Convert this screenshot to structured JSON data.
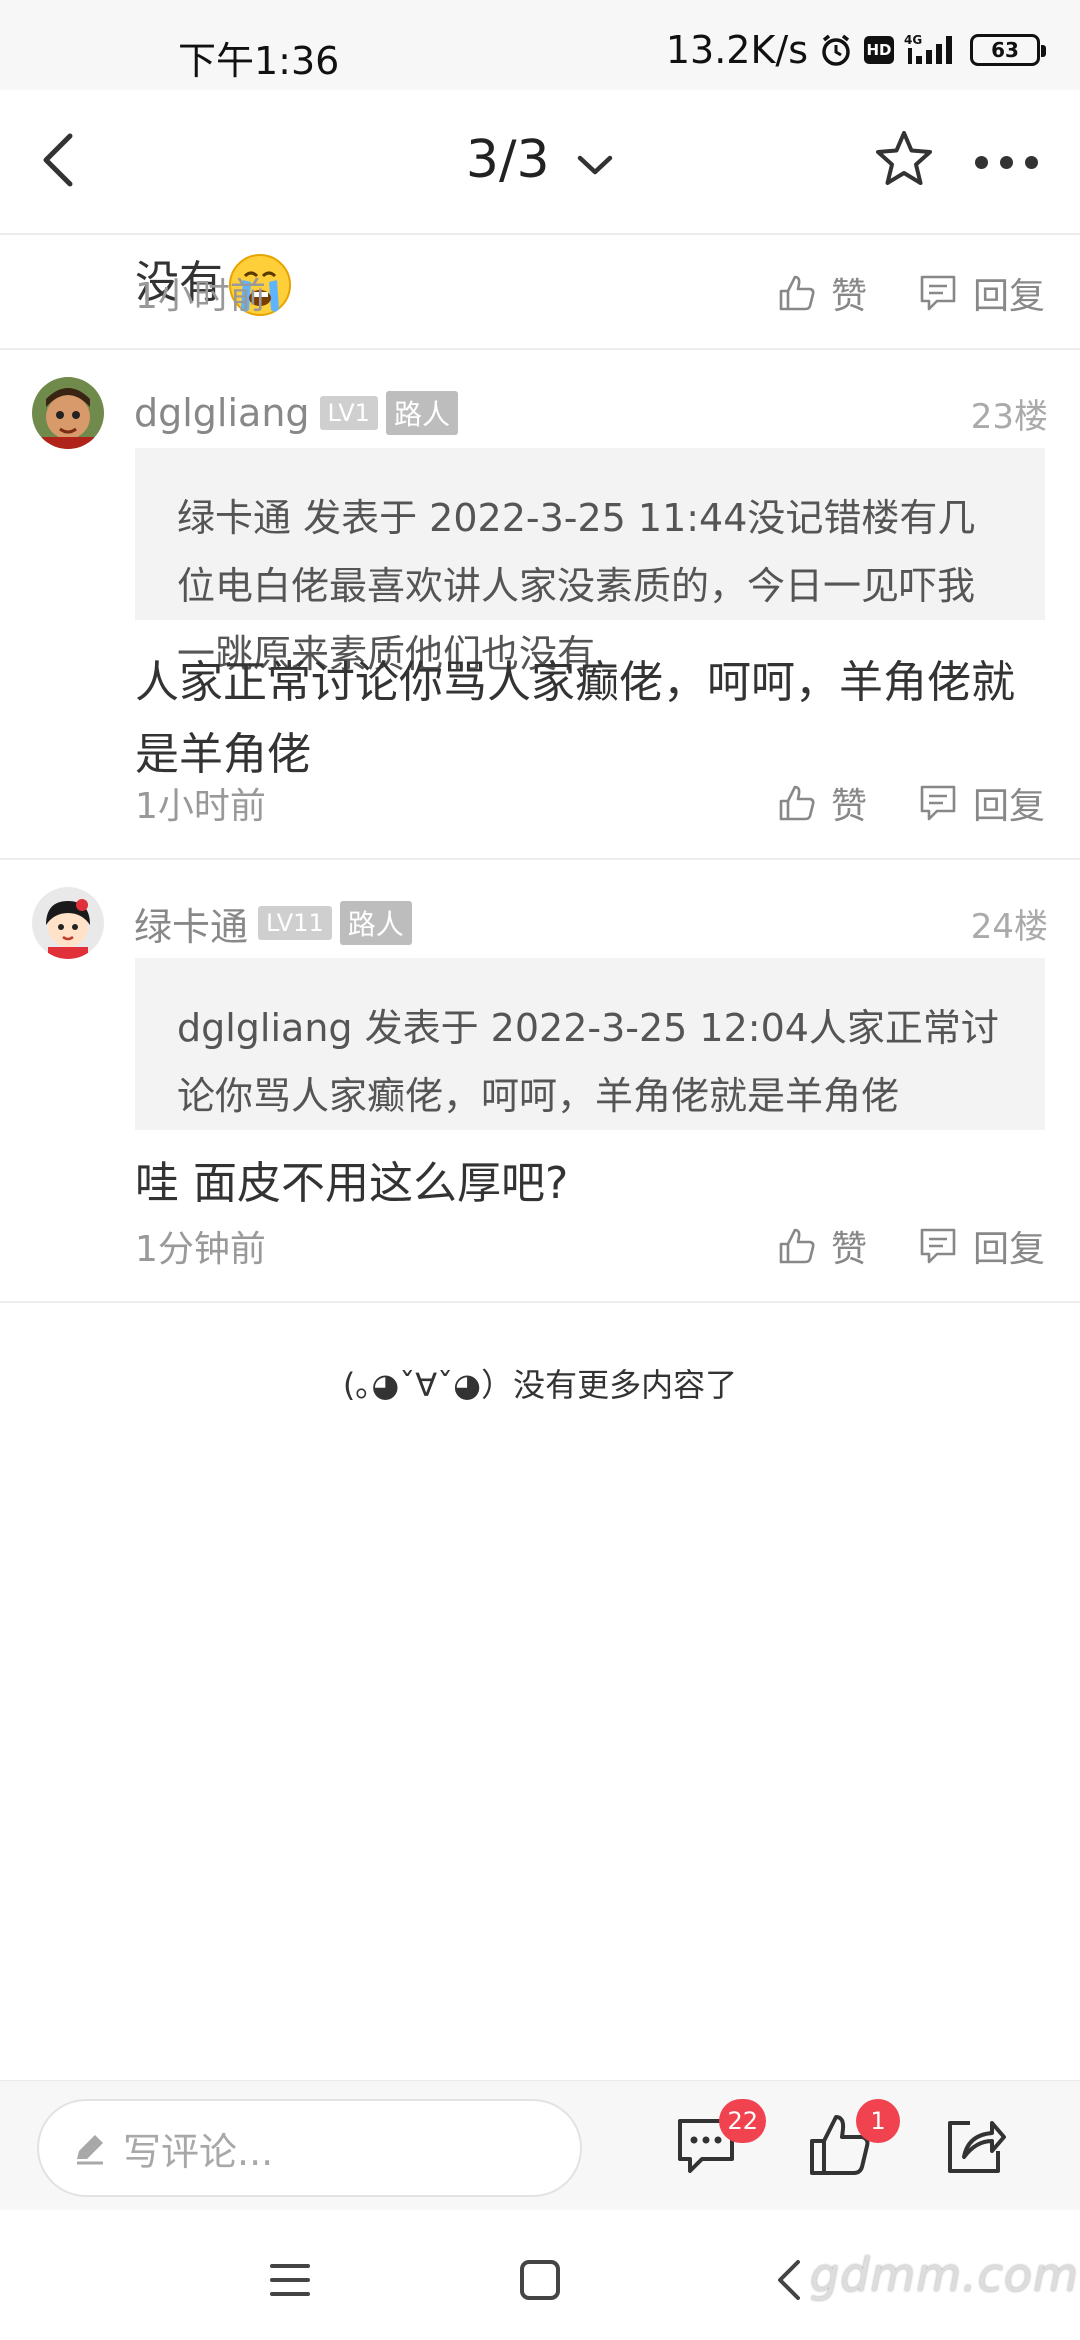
{
  "status_bar": {
    "time": "下午1:36",
    "speed": "13.2K/s",
    "network": "4G",
    "hd": "HD",
    "battery": "63"
  },
  "nav": {
    "page_indicator": "3/3"
  },
  "partial_post": {
    "text_tail": "没有",
    "time": "1小时前",
    "like_label": "赞",
    "reply_label": "回复"
  },
  "posts": [
    {
      "username": "dglgliang",
      "level": "LV1",
      "role": "路人",
      "floor": "23楼",
      "quote": "绿卡通 发表于 2022-3-25 11:44没记错楼有几位电白佬最喜欢讲人家没素质的，今日一见吓我一跳原来素质他们也没有",
      "body": "人家正常讨论你骂人家癫佬，呵呵，羊角佬就是羊角佬",
      "time": "1小时前",
      "like_label": "赞",
      "reply_label": "回复"
    },
    {
      "username": "绿卡通",
      "level": "LV11",
      "role": "路人",
      "floor": "24楼",
      "quote": "dglgliang 发表于 2022-3-25 12:04人家正常讨论你骂人家癫佬，呵呵，羊角佬就是羊角佬",
      "body": "哇 面皮不用这么厚吧?",
      "time": "1分钟前",
      "like_label": "赞",
      "reply_label": "回复"
    }
  ],
  "no_more": "(｡◕ˇ∀ˇ◕）没有更多内容了",
  "bottom_bar": {
    "comment_placeholder": "写评论...",
    "comment_count": "22",
    "like_count": "1"
  },
  "watermark": "gdmm.com",
  "colors": {
    "badge_red": "#f0434f",
    "quote_bg": "#f3f3f3",
    "meta_gray": "#999999"
  }
}
